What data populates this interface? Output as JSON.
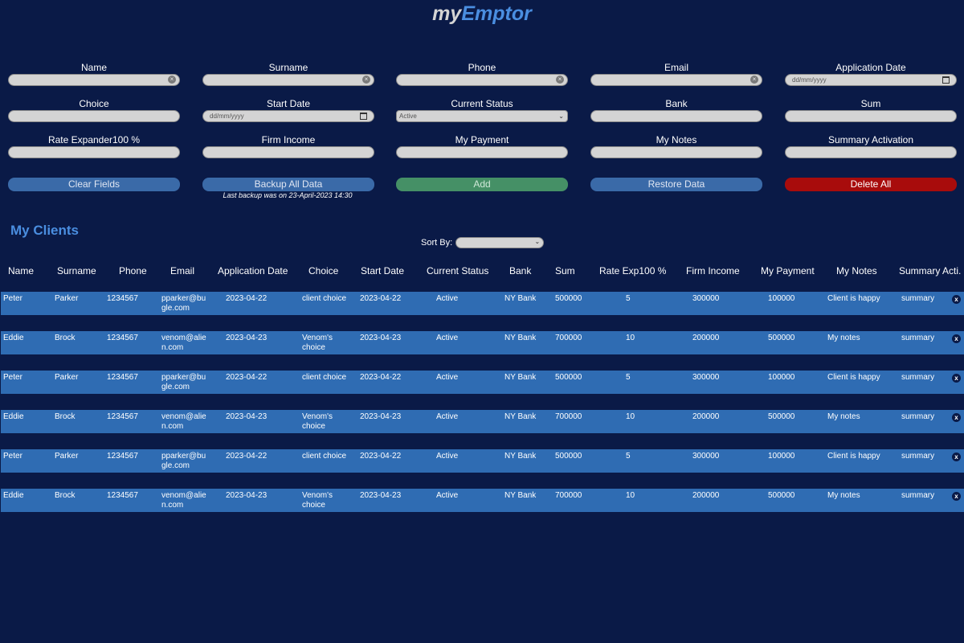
{
  "app": {
    "logo_my": "my",
    "logo_emptor": "Emptor"
  },
  "form": {
    "name": {
      "label": "Name",
      "value": ""
    },
    "surname": {
      "label": "Surname",
      "value": ""
    },
    "phone": {
      "label": "Phone",
      "value": ""
    },
    "email": {
      "label": "Email",
      "value": ""
    },
    "application_date": {
      "label": "Application Date",
      "placeholder": "dd/mm/yyyy"
    },
    "choice": {
      "label": "Choice",
      "value": ""
    },
    "start_date": {
      "label": "Start Date",
      "placeholder": "dd/mm/yyyy"
    },
    "current_status": {
      "label": "Current Status",
      "selected": "Active"
    },
    "bank": {
      "label": "Bank",
      "value": ""
    },
    "sum": {
      "label": "Sum",
      "value": ""
    },
    "rate": {
      "label": "Rate Expander100 %",
      "value": ""
    },
    "firm_income": {
      "label": "Firm Income",
      "value": ""
    },
    "my_payment": {
      "label": "My Payment",
      "value": ""
    },
    "my_notes": {
      "label": "My Notes",
      "value": ""
    },
    "summary_activation": {
      "label": "Summary Activation",
      "value": ""
    }
  },
  "buttons": {
    "clear": "Clear Fields",
    "backup": "Backup All Data",
    "add": "Add",
    "restore": "Restore Data",
    "delete_all": "Delete All"
  },
  "backup_note": "Last backup was on 23-April-2023 14:30",
  "clients": {
    "title": "My Clients",
    "sort_label": "Sort By:",
    "sort_value": "",
    "columns": [
      "Name",
      "Surname",
      "Phone",
      "Email",
      "Application Date",
      "Choice",
      "Start Date",
      "Current Status",
      "Bank",
      "Sum",
      "Rate Exp100 %",
      "Firm Income",
      "My Payment",
      "My Notes",
      "Summary Acti."
    ],
    "rows": [
      {
        "name": "Peter",
        "surname": "Parker",
        "phone": "1234567",
        "email1": "pparker@bu",
        "email2": "gle.com",
        "app_date": "2023-04-22",
        "choice1": "client choice",
        "choice2": "",
        "start_date": "2023-04-22",
        "status": "Active",
        "bank": "NY Bank",
        "sum": "500000",
        "rate": "5",
        "firm_income": "300000",
        "my_payment": "100000",
        "notes": "Client is happy",
        "summary": "summary",
        "delete": "x"
      },
      {
        "name": "Eddie",
        "surname": "Brock",
        "phone": "1234567",
        "email1": "venom@alie",
        "email2": "n.com",
        "app_date": "2023-04-23",
        "choice1": "Venom's",
        "choice2": "choice",
        "start_date": "2023-04-23",
        "status": "Active",
        "bank": "NY Bank",
        "sum": "700000",
        "rate": "10",
        "firm_income": "200000",
        "my_payment": "500000",
        "notes": "My notes",
        "summary": "summary",
        "delete": "x"
      },
      {
        "name": "Peter",
        "surname": "Parker",
        "phone": "1234567",
        "email1": "pparker@bu",
        "email2": "gle.com",
        "app_date": "2023-04-22",
        "choice1": "client choice",
        "choice2": "",
        "start_date": "2023-04-22",
        "status": "Active",
        "bank": "NY Bank",
        "sum": "500000",
        "rate": "5",
        "firm_income": "300000",
        "my_payment": "100000",
        "notes": "Client is happy",
        "summary": "summary",
        "delete": "x"
      },
      {
        "name": "Eddie",
        "surname": "Brock",
        "phone": "1234567",
        "email1": "venom@alie",
        "email2": "n.com",
        "app_date": "2023-04-23",
        "choice1": "Venom's",
        "choice2": "choice",
        "start_date": "2023-04-23",
        "status": "Active",
        "bank": "NY Bank",
        "sum": "700000",
        "rate": "10",
        "firm_income": "200000",
        "my_payment": "500000",
        "notes": "My notes",
        "summary": "summary",
        "delete": "x"
      },
      {
        "name": "Peter",
        "surname": "Parker",
        "phone": "1234567",
        "email1": "pparker@bu",
        "email2": "gle.com",
        "app_date": "2023-04-22",
        "choice1": "client choice",
        "choice2": "",
        "start_date": "2023-04-22",
        "status": "Active",
        "bank": "NY Bank",
        "sum": "500000",
        "rate": "5",
        "firm_income": "300000",
        "my_payment": "100000",
        "notes": "Client is happy",
        "summary": "summary",
        "delete": "x"
      },
      {
        "name": "Eddie",
        "surname": "Brock",
        "phone": "1234567",
        "email1": "venom@alie",
        "email2": "n.com",
        "app_date": "2023-04-23",
        "choice1": "Venom's",
        "choice2": "choice",
        "start_date": "2023-04-23",
        "status": "Active",
        "bank": "NY Bank",
        "sum": "700000",
        "rate": "10",
        "firm_income": "200000",
        "my_payment": "500000",
        "notes": "My notes",
        "summary": "summary",
        "delete": "x"
      }
    ]
  },
  "colors": {
    "background": "#0a1a47",
    "accent": "#4a8ee0",
    "row_bg": "#2f6cb3",
    "button_blue": "#3a6aa8",
    "button_green": "#459066",
    "button_red": "#a80c0c"
  }
}
